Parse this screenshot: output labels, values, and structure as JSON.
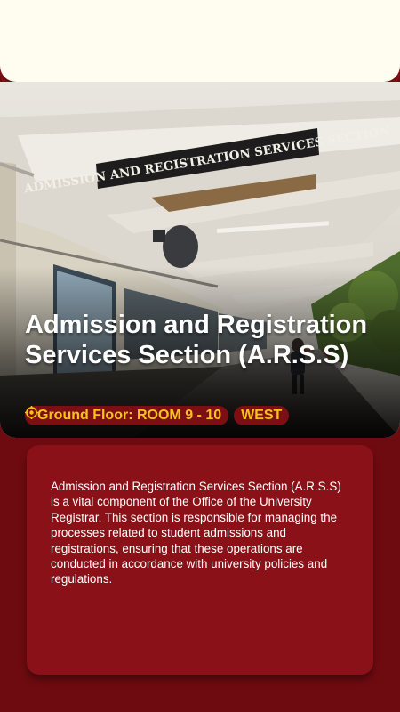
{
  "hero": {
    "sign_text": "ADMISSION AND REGISTRATION SERVICES SECTION",
    "title": "Admission and Registration Services Section (A.R.S.S)",
    "location_icon": "target-icon",
    "location": "Ground Floor: ROOM 9 - 10",
    "direction": "WEST"
  },
  "description": {
    "text": "Admission and Registration Services Section (A.R.S.S) is a vital component of the Office of the University Registrar. This section is responsible for managing the processes related to student admissions and registrations, ensuring that these operations are conducted in accordance with university policies and regulations."
  },
  "colors": {
    "background": "#6e0b10",
    "card": "#8a1117",
    "accent": "#f5c417",
    "top_panel": "#fffdf0"
  }
}
